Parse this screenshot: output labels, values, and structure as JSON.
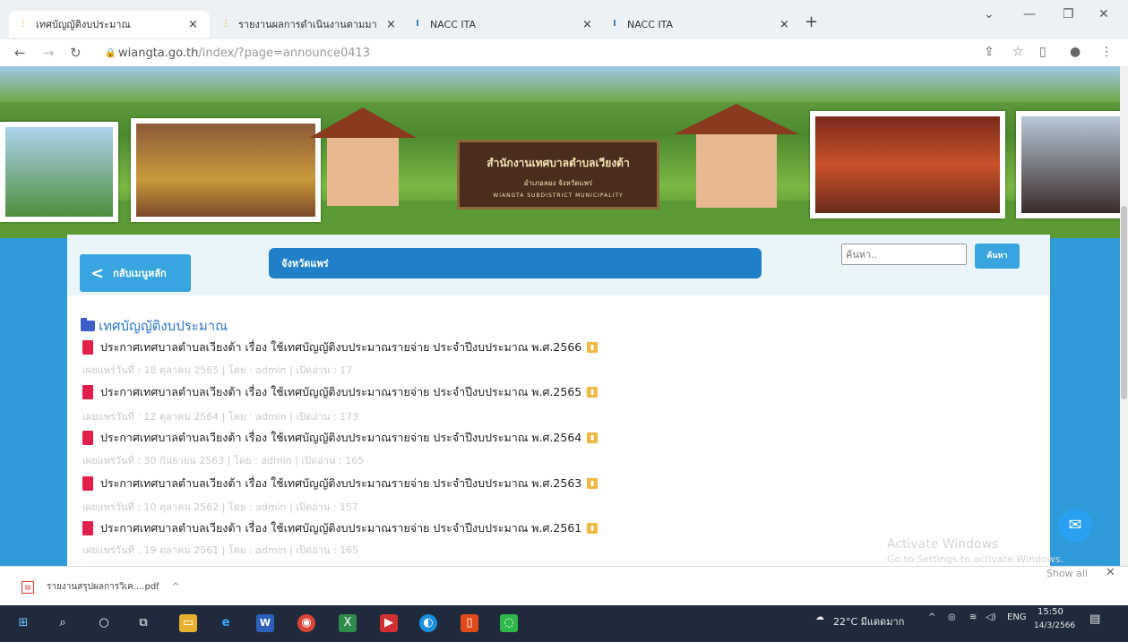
{
  "browser": {
    "tabs": [
      {
        "label": "เทศบัญญัติงบประมาณ",
        "active": true
      },
      {
        "label": "รายงานผลการดำเนินงานตามมาตรการ",
        "active": false
      },
      {
        "label": "NACC ITA",
        "active": false
      },
      {
        "label": "NACC ITA",
        "active": false
      }
    ],
    "tab_close": "×",
    "new_tab": "+",
    "url_host": "wiangta.go.th",
    "url_path": "/index/?page=announce0413"
  },
  "banner": {
    "sign_title": "สำนักงานเทศบาลตำบลเวียงต้า",
    "sign_sub": "อำเภอลอง จังหวัดแพร่",
    "sign_sub2": "WIANGTA SUBDISTRICT MUNICIPALITY"
  },
  "page": {
    "back_label": "กลับเมนูหลัก",
    "province_label": "จังหวัดแพร่",
    "search_placeholder": "ค้นหา..",
    "search_button": "ค้นหา",
    "category": "เทศบัญญัติงบประมาณ",
    "documents": [
      {
        "title": "ประกาศเทศบาลตำบลเวียงต้า เรื่อง ใช้เทศบัญญัติงบประมาณรายจ่าย ประจำปีงบประมาณ พ.ศ.2566",
        "meta": "เผยแพร่วันที่ : 18 ตุลาคม 2565 | โดย : admin | เปิดอ่าน : 17"
      },
      {
        "title": "ประกาศเทศบาลตำบลเวียงต้า เรื่อง ใช้เทศบัญญัติงบประมาณรายจ่าย ประจำปีงบประมาณ พ.ศ.2565",
        "meta": "เผยแพร่วันที่ : 12 ตุลาคม 2564 | โดย : admin | เปิดอ่าน : 173"
      },
      {
        "title": "ประกาศเทศบาลตำบลเวียงต้า เรื่อง ใช้เทศบัญญัติงบประมาณรายจ่าย ประจำปีงบประมาณ พ.ศ.2564",
        "meta": "เผยแพร่วันที่ : 30 กันยายน 2563 | โดย : admin | เปิดอ่าน : 165"
      },
      {
        "title": "ประกาศเทศบาลตำบลเวียงต้า เรื่อง ใช้เทศบัญญัติงบประมาณรายจ่าย ประจำปีงบประมาณ พ.ศ.2563",
        "meta": "เผยแพร่วันที่ : 10 ตุลาคม 2562 | โดย : admin | เปิดอ่าน : 157"
      },
      {
        "title": "ประกาศเทศบาลตำบลเวียงต้า เรื่อง ใช้เทศบัญญัติงบประมาณรายจ่าย ประจำปีงบประมาณ พ.ศ.2561",
        "meta": "เผยแพร่วันที่ : 19 ตุลาคม 2561 | โดย : admin | เปิดอ่าน : 165"
      }
    ],
    "watermark_line1": "Activate Windows",
    "watermark_line2": "Go to Settings to activate Windows."
  },
  "downloads": {
    "file_name": "รายงานสรุปผลการวิเค....pdf",
    "show_all": "Show all"
  },
  "taskbar": {
    "weather": "22°C มีแดดมาก",
    "language": "ENG",
    "time": "15:50",
    "date": "14/3/2566"
  },
  "colors": {
    "page_blue": "#2e9ad9",
    "button_blue": "#39a5e0",
    "province_blue": "#1f80c9",
    "pdf_red": "#e0204a",
    "stat_orange": "#f0b840"
  }
}
